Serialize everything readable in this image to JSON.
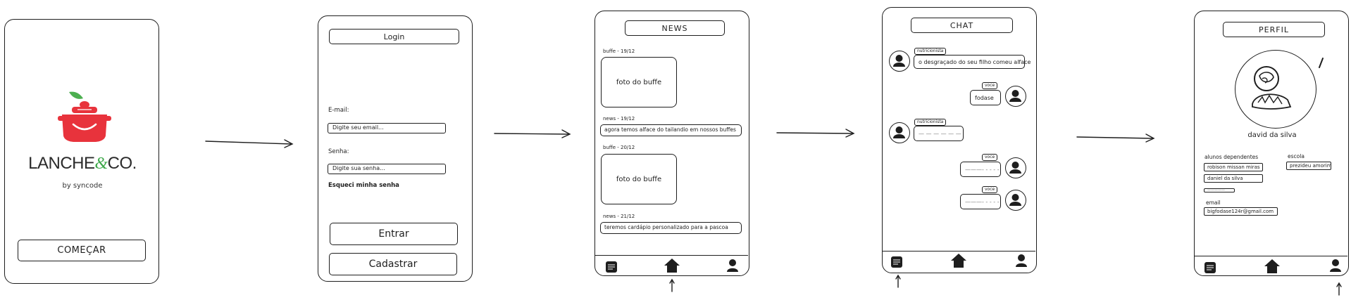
{
  "colors": {
    "ink": "#1e1e1e",
    "brand_red": "#e8333c",
    "brand_green": "#3ea84a",
    "leaf_green": "#4caf50"
  },
  "splash": {
    "brand_lanche": "LANCHE",
    "brand_amp": "&",
    "brand_co": "CO.",
    "byline": "by syncode",
    "start_button": "COMEÇAR"
  },
  "login": {
    "title": "Login",
    "email_label": "E-mail:",
    "email_placeholder": "Digite seu email...",
    "password_label": "Senha:",
    "password_placeholder": "Digite sua senha...",
    "forgot": "Esqueci minha senha",
    "enter_button": "Entrar",
    "register_button": "Cadastrar"
  },
  "news": {
    "title": "NEWS",
    "items": [
      {
        "label": "buffe - 19/12",
        "kind": "photo",
        "content": "foto do buffe"
      },
      {
        "label": "news - 19/12",
        "kind": "text",
        "content": "agora temos alface do tailandio em nossos buffes"
      },
      {
        "label": "buffe - 20/12",
        "kind": "photo",
        "content": "foto do buffe"
      },
      {
        "label": "news - 21/12",
        "kind": "text",
        "content": "teremos cardápio personalizado para a pascoa"
      }
    ]
  },
  "chat": {
    "title": "CHAT",
    "messages": [
      {
        "sender": "nutricionista",
        "text": "o desgraçado do seu filho comeu alface"
      },
      {
        "sender": "voce",
        "text": "fodase"
      },
      {
        "sender": "nutricionista",
        "text": "— — — — — —"
      },
      {
        "sender": "voce",
        "text": "———- - - - -"
      },
      {
        "sender": "voce",
        "text": "———- - - - -"
      }
    ]
  },
  "profile": {
    "title": "PERFIL",
    "name": "david da silva",
    "dependents_label": "alunos dependentes",
    "dependents": [
      "robison missan miras",
      "daniel da silva",
      "—————"
    ],
    "school_label": "escola",
    "school": "prezideu amorim",
    "email_label": "email",
    "email": "bigfodase124r@gmail.com"
  },
  "icons": [
    "news-icon",
    "home-icon",
    "profile-icon",
    "apple-logo-icon",
    "pot-logo-icon",
    "avatar-icon",
    "edit-pencil-icon",
    "flow-arrow-icon"
  ]
}
